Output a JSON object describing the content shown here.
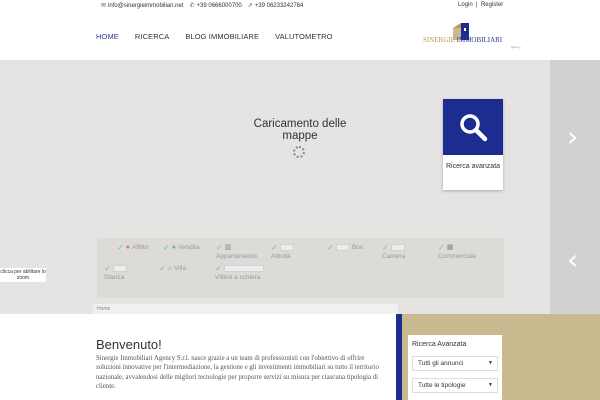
{
  "topbar": {
    "email": "info@sinergieimmobiliari.net",
    "phone1": "+39 0666000700",
    "phone2": "+39 06233242784",
    "login": "Login",
    "separator": "|",
    "register": "Register"
  },
  "nav": {
    "items": [
      "HOME",
      "RICERCA",
      "BLOG IMMOBILIARE",
      "VALUTOMETRO"
    ],
    "active_index": 0
  },
  "logo": {
    "text_part1": "SINERGIE",
    "text_part2": "IMMOBILIARI",
    "sub": "agency"
  },
  "map": {
    "loading": "Caricamento delle mappe",
    "zoom_tip": "clicca per abilitare lo zoom"
  },
  "search_card": {
    "label": "Ricerca avanzata"
  },
  "filters": {
    "affitto": "Affitto",
    "vendita": "Vendita",
    "appartamento": "Appartamento",
    "attivita": "Attività",
    "box": "Box",
    "camera": "Camera",
    "commerciale": "Commerciale",
    "stanza": "Stanza",
    "villa": "Villa",
    "villino": "Villino a schiera"
  },
  "breadcrumb": "Home",
  "content": {
    "title": "Benvenuto!",
    "paragraph": "Sinergie Immobiliari Agency S.r.l. nasce grazie a un team di professionisti con l'obiettivo di offrire soluzioni innovative per l'intermediazione, la gestione e gli investimenti immobiliari su tutto il territorio nazionale, avvalendosi delle migliori tecnologie per proporre servizi su misura per ciascuna tipologia di cliente."
  },
  "advanced_search": {
    "title": "Ricerca Avanzata",
    "select1": "Tutti gli annunci",
    "select2": "Tutte le tipologie"
  },
  "colors": {
    "navy": "#1c2d8f",
    "gold": "#c8b98f",
    "map_bg": "#e5e4e2"
  }
}
